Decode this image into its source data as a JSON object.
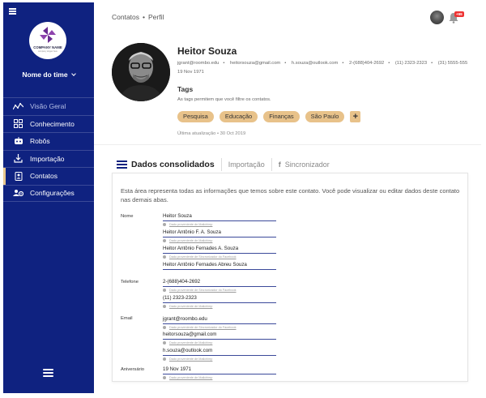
{
  "sidebar": {
    "logo_text": "COMPANY NAME",
    "logo_sub": "company slogan here",
    "team_label": "Nome do time",
    "items": [
      {
        "label": "Visão Geral",
        "icon": "chart-line-icon"
      },
      {
        "label": "Conhecimento",
        "icon": "grid-icon"
      },
      {
        "label": "Robôs",
        "icon": "robot-icon"
      },
      {
        "label": "Importação",
        "icon": "import-icon"
      },
      {
        "label": "Contatos",
        "icon": "contact-book-icon"
      },
      {
        "label": "Configurações",
        "icon": "users-gear-icon"
      }
    ]
  },
  "topbar": {
    "breadcrumb_root": "Contatos",
    "breadcrumb_sep": "•",
    "breadcrumb_current": "Perfil",
    "notification_count": "+99"
  },
  "profile": {
    "name": "Heitor Souza",
    "contacts": [
      "jgrant@roombo.edu",
      "heitorsouza@gmail.com",
      "h.souza@outlook.com",
      "2-(688)404-2692",
      "(11) 2323-2323",
      "(31) 5555-555"
    ],
    "birthdate": "19 Nov 1971",
    "tags_title": "Tags",
    "tags_desc": "As tags permitem que você filtre os contatos.",
    "tags": [
      "Pesquisa",
      "Educação",
      "Finanças",
      "São Paulo"
    ],
    "tag_add": "+",
    "updated": "Última atualização • 30 Oct 2019"
  },
  "tabs": [
    {
      "label": "Dados consolidados",
      "active": true
    },
    {
      "label": "Importação",
      "active": false
    },
    {
      "label": "Sincronizador",
      "active": false
    }
  ],
  "panel": {
    "description": "Esta área representa todas as informações que temos sobre este contato. Você pode visualizar ou editar dados deste contato nas demais abas.",
    "groups": [
      {
        "label": "Nome",
        "entries": [
          {
            "value": "Heitor Souza",
            "source": "Dado proveniente de Mailchimp"
          },
          {
            "value": "Heitor Antônio F. A. Souza",
            "source": "Dado proveniente de Mailchimp"
          },
          {
            "value": "Heitor Antônio Fernades A. Souza",
            "source": "Dado proveniente de Sincronizador do Facebook"
          },
          {
            "value": "Heitor Antônio Fernades Abreu Souza",
            "source": ""
          }
        ]
      },
      {
        "label": "Telefone",
        "entries": [
          {
            "value": "2-(688)404-2692",
            "source": "Dado proveniente de Sincronizador do Facebook"
          },
          {
            "value": "(11) 2323-2323",
            "source": "Dado proveniente de Mailchimp"
          }
        ]
      },
      {
        "label": "Email",
        "entries": [
          {
            "value": "jgrant@roombo.edu",
            "source": "Dado proveniente de Sincronizador do Facebook"
          },
          {
            "value": "heitorsouza@gmail.com",
            "source": "Dado proveniente de Mailchimp"
          },
          {
            "value": "h.souza@outlook.com",
            "source": "Dado proveniente de Mailchimp"
          }
        ]
      },
      {
        "label": "Aniversário",
        "entries": [
          {
            "value": "19 Nov 1971",
            "source": "Dado proveniente de Mailchimp"
          }
        ]
      }
    ]
  },
  "colors": {
    "sidebar_bg": "#0f2280",
    "tag_bg": "#e8c28a",
    "badge_bg": "#e33333",
    "accent_line": "#3b4a9a"
  }
}
